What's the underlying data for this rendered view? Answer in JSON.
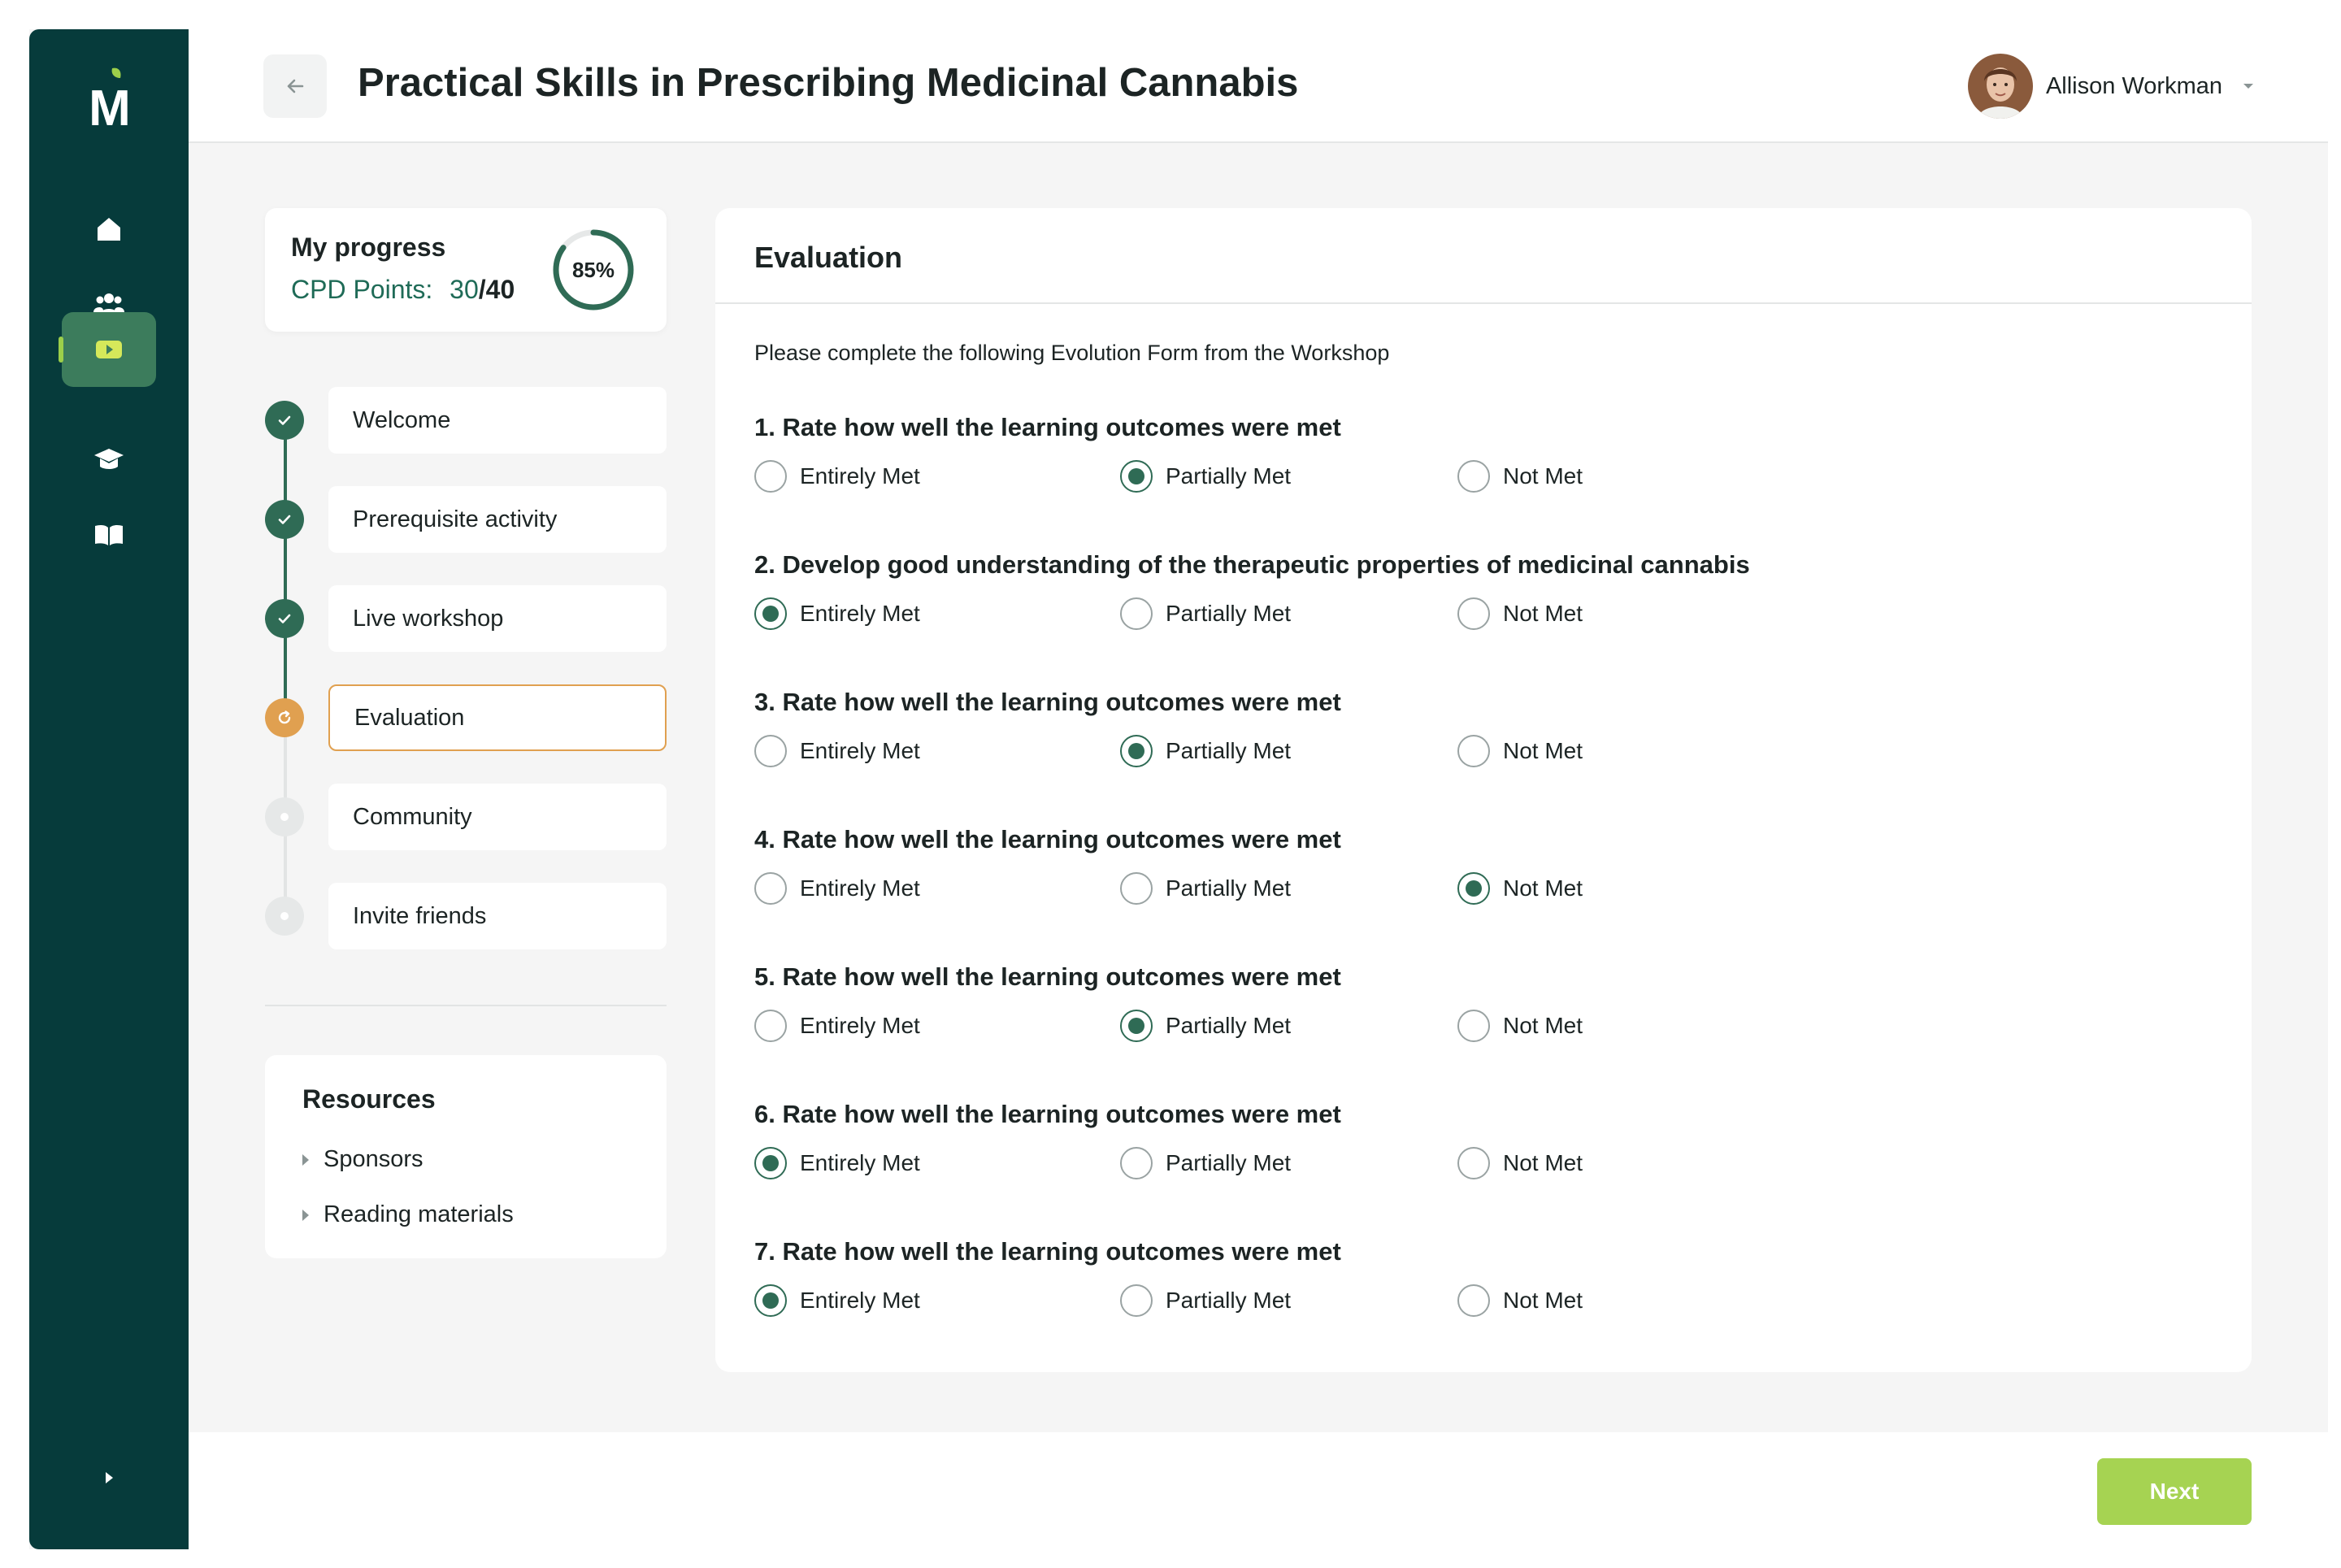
{
  "colors": {
    "sidebar": "#063b3b",
    "accent_green": "#2f6b55",
    "current_orange": "#e0a050",
    "next_button": "#a6d352"
  },
  "sidebar": {
    "logo_letter": "M",
    "items": [
      {
        "icon": "home-icon",
        "active": false
      },
      {
        "icon": "users-icon",
        "active": false
      },
      {
        "icon": "video-icon",
        "active": true
      },
      {
        "icon": "graduation-cap-icon",
        "active": false
      },
      {
        "icon": "book-open-icon",
        "active": false
      }
    ],
    "collapse_icon": "chevron-right-icon"
  },
  "header": {
    "back_icon": "arrow-left-icon",
    "title": "Practical Skills in Prescribing Medicinal Cannabis",
    "user_name": "Allison Workman",
    "dropdown_icon": "caret-down-icon"
  },
  "progress": {
    "title": "My progress",
    "cpd_label": "CPD Points:",
    "cpd_earned": "30",
    "cpd_sep": "/",
    "cpd_total": "40",
    "percent_label": "85%",
    "percent": 85
  },
  "steps": [
    {
      "label": "Welcome",
      "status": "done"
    },
    {
      "label": "Prerequisite activity",
      "status": "done"
    },
    {
      "label": "Live workshop",
      "status": "done"
    },
    {
      "label": "Evaluation",
      "status": "current"
    },
    {
      "label": "Community",
      "status": "todo"
    },
    {
      "label": "Invite friends",
      "status": "todo"
    }
  ],
  "resources": {
    "title": "Resources",
    "items": [
      "Sponsors",
      "Reading materials"
    ]
  },
  "evaluation": {
    "title": "Evaluation",
    "intro": "Please complete the following Evolution Form from the Workshop",
    "options": [
      "Entirely Met",
      "Partially Met",
      "Not Met"
    ],
    "questions": [
      {
        "text": "1. Rate how well the learning outcomes were met",
        "selected": "Partially Met"
      },
      {
        "text": "2. Develop good understanding of the therapeutic properties of medicinal cannabis",
        "selected": "Entirely Met"
      },
      {
        "text": "3. Rate how well the learning outcomes were met",
        "selected": "Partially Met"
      },
      {
        "text": "4. Rate how well the learning outcomes were met",
        "selected": "Not Met"
      },
      {
        "text": "5. Rate how well the learning outcomes were met",
        "selected": "Partially Met"
      },
      {
        "text": "6. Rate how well the learning outcomes were met",
        "selected": "Entirely Met"
      },
      {
        "text": "7. Rate how well the learning outcomes were met",
        "selected": "Entirely Met"
      }
    ]
  },
  "footer": {
    "next_label": "Next"
  }
}
